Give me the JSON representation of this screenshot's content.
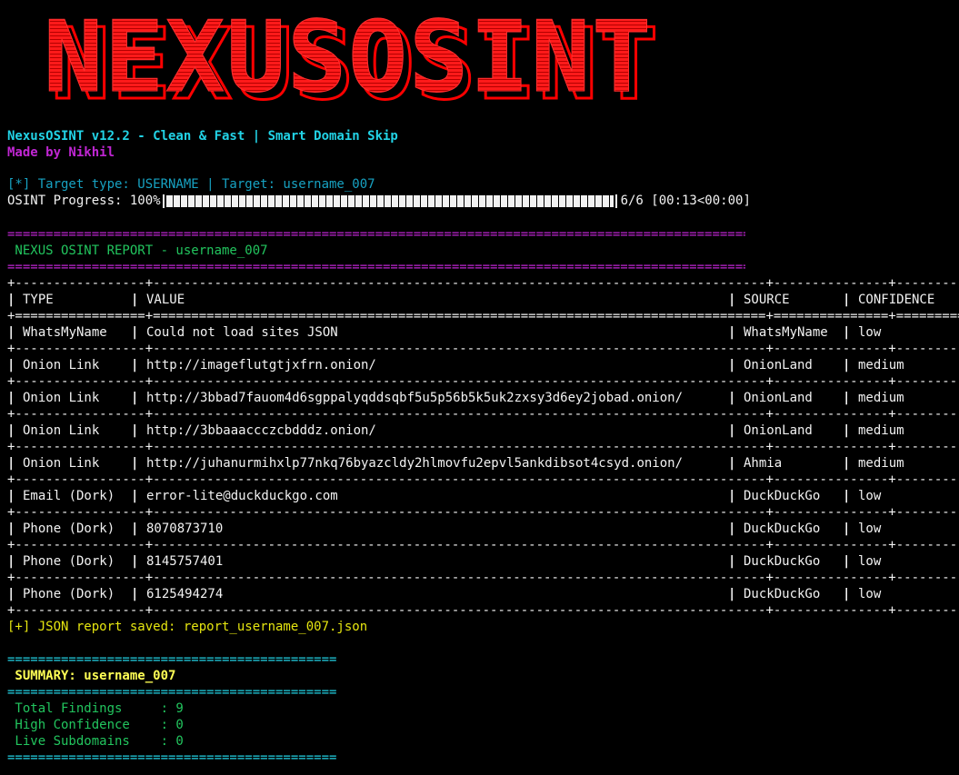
{
  "banner": {
    "logo_text": "NEXUSOSINT",
    "color": "#ff0000"
  },
  "header": {
    "version_line": "NexusOSINT v12.2 - Clean & Fast | Smart Domain Skip",
    "credit_line": "Made by Nikhil"
  },
  "target_line": "[*] Target type: USERNAME | Target: username_007",
  "progress": {
    "label": "OSINT Progress: 100%",
    "percent": 100,
    "status": "6/6 [00:13<00:00]"
  },
  "report": {
    "divider": "=====================================================================================================================",
    "title": " NEXUS OSINT REPORT - username_007"
  },
  "table": {
    "columns": [
      "TYPE",
      "VALUE",
      "SOURCE",
      "CONFIDENCE"
    ],
    "rows": [
      [
        "WhatsMyName",
        "Could not load sites JSON",
        "WhatsMyName",
        "low"
      ],
      [
        "Onion Link",
        "http://imageflutgtjxfrn.onion/",
        "OnionLand",
        "medium"
      ],
      [
        "Onion Link",
        "http://3bbad7fauom4d6sgppalyqddsqbf5u5p56b5k5uk2zxsy3d6ey2jobad.onion/",
        "OnionLand",
        "medium"
      ],
      [
        "Onion Link",
        "http://3bbaaaccczcbdddz.onion/",
        "OnionLand",
        "medium"
      ],
      [
        "Onion Link",
        "http://juhanurmihxlp77nkq76byazcldy2hlmovfu2epvl5ankdibsot4csyd.onion/",
        "Ahmia",
        "medium"
      ],
      [
        "Email (Dork)",
        "error-lite@duckduckgo.com",
        "DuckDuckGo",
        "low"
      ],
      [
        "Phone (Dork)",
        "8070873710",
        "DuckDuckGo",
        "low"
      ],
      [
        "Phone (Dork)",
        "8145757401",
        "DuckDuckGo",
        "low"
      ],
      [
        "Phone (Dork)",
        "6125494274",
        "DuckDuckGo",
        "low"
      ]
    ]
  },
  "saved_line": "[+] JSON report saved: report_username_007.json",
  "summary": {
    "divider": "=====================================================",
    "title": " SUMMARY: username_007",
    "lines": [
      " Total Findings     : 9",
      " High Confidence    : 0",
      " Live Subdomains    : 0"
    ]
  },
  "colors": {
    "background": "#000000",
    "banner": "#ff0000",
    "cyan": "#22d3e6",
    "magenta": "#c026d3",
    "green": "#22c55e",
    "yellow": "#e5e510"
  }
}
